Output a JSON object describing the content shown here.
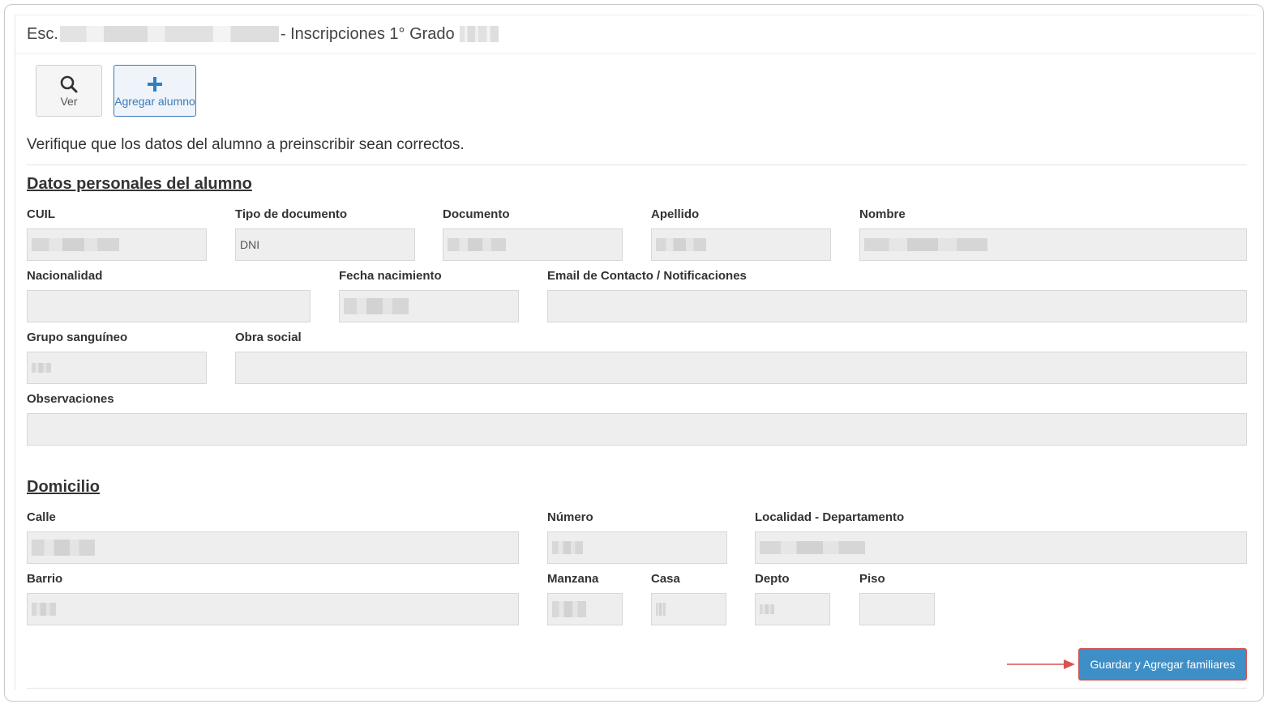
{
  "header": {
    "title_prefix": "Esc.",
    "title_middle": "- Inscripciones 1° Grado"
  },
  "toolbar": {
    "ver_label": "Ver",
    "add_label": "Agregar alumno"
  },
  "instructions": "Verifique que los datos del alumno a preinscribir sean correctos.",
  "personal": {
    "section_title": "Datos personales del alumno",
    "labels": {
      "cuil": "CUIL",
      "tipo_documento": "Tipo de documento",
      "documento": "Documento",
      "apellido": "Apellido",
      "nombre": "Nombre",
      "nacionalidad": "Nacionalidad",
      "fecha_nacimiento": "Fecha nacimiento",
      "email": "Email de Contacto / Notificaciones",
      "grupo_sanguineo": "Grupo sanguíneo",
      "obra_social": "Obra social",
      "observaciones": "Observaciones"
    },
    "values": {
      "tipo_documento": "DNI"
    }
  },
  "domicilio": {
    "section_title": "Domicilio",
    "labels": {
      "calle": "Calle",
      "numero": "Número",
      "localidad": "Localidad - Departamento",
      "barrio": "Barrio",
      "manzana": "Manzana",
      "casa": "Casa",
      "depto": "Depto",
      "piso": "Piso"
    }
  },
  "actions": {
    "save_label": "Guardar y Agregar familiares"
  },
  "colors": {
    "primary": "#3f8fc7",
    "highlight_border": "#d9534f",
    "field_bg": "#eeeeee"
  }
}
